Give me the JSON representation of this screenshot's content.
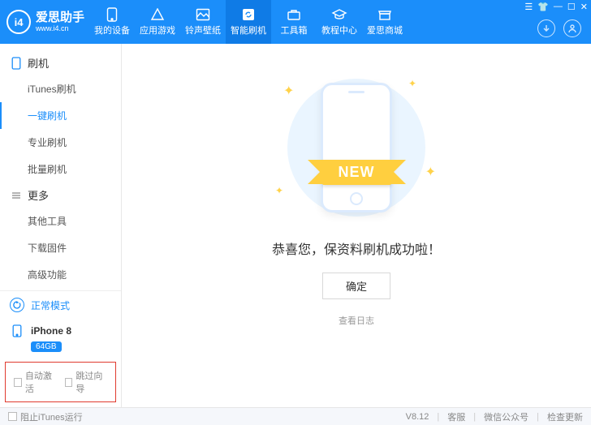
{
  "brand": {
    "name": "爱思助手",
    "url": "www.i4.cn",
    "logo_text": "i4"
  },
  "nav": {
    "items": [
      {
        "label": "我的设备"
      },
      {
        "label": "应用游戏"
      },
      {
        "label": "铃声壁纸"
      },
      {
        "label": "智能刷机"
      },
      {
        "label": "工具箱"
      },
      {
        "label": "教程中心"
      },
      {
        "label": "爱思商城"
      }
    ],
    "active_index": 3
  },
  "sidebar": {
    "groups": [
      {
        "title": "刷机",
        "items": [
          "iTunes刷机",
          "一键刷机",
          "专业刷机",
          "批量刷机"
        ],
        "active_index": 1
      },
      {
        "title": "更多",
        "items": [
          "其他工具",
          "下载固件",
          "高级功能"
        ],
        "active_index": -1
      }
    ],
    "mode_label": "正常模式",
    "device_name": "iPhone 8",
    "device_storage": "64GB",
    "checks": {
      "auto_activate": "自动激活",
      "skip_wizard": "跳过向导"
    }
  },
  "main": {
    "ribbon_text": "NEW",
    "headline": "恭喜您，保资料刷机成功啦！",
    "ok_button": "确定",
    "log_link": "查看日志"
  },
  "footer": {
    "block_itunes": "阻止iTunes运行",
    "version": "V8.12",
    "support": "客服",
    "wechat": "微信公众号",
    "update": "检查更新"
  }
}
